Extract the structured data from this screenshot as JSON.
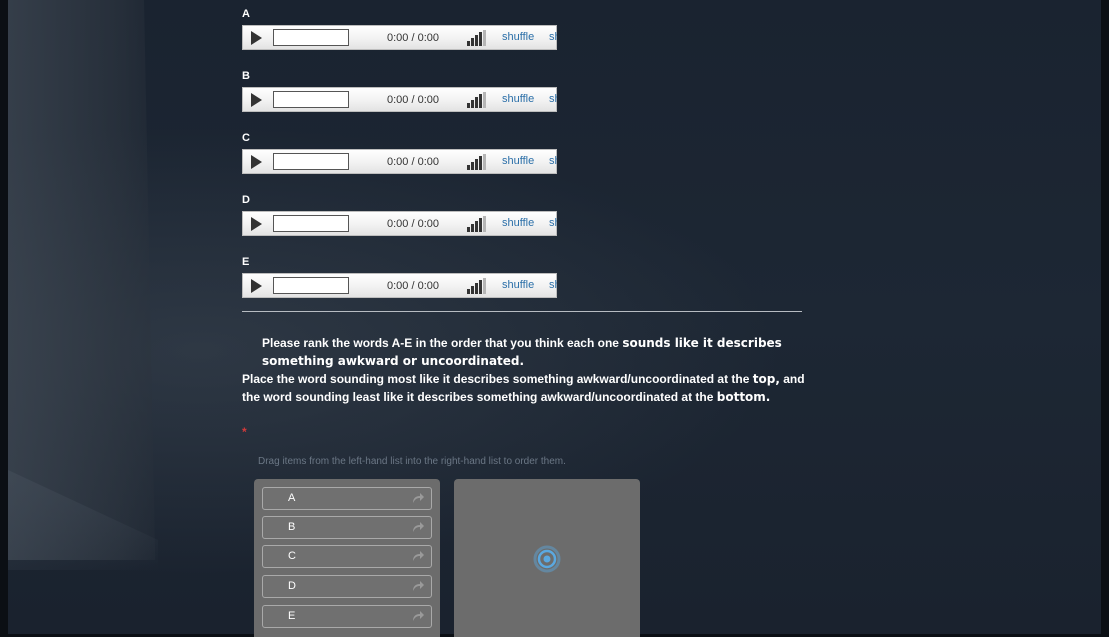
{
  "players": [
    {
      "letter": "A",
      "time": "0:00 / 0:00",
      "shuffle": "shuffle",
      "clipped": "sh"
    },
    {
      "letter": "B",
      "time": "0:00 / 0:00",
      "shuffle": "shuffle",
      "clipped": "sh"
    },
    {
      "letter": "C",
      "time": "0:00 / 0:00",
      "shuffle": "shuffle",
      "clipped": "sh"
    },
    {
      "letter": "D",
      "time": "0:00 / 0:00",
      "shuffle": "shuffle",
      "clipped": "sh"
    },
    {
      "letter": "E",
      "time": "0:00 / 0:00",
      "shuffle": "shuffle",
      "clipped": "sh"
    }
  ],
  "question": {
    "part1": "Please rank the words A-E in the order that you think each one ",
    "part1_strong": "sounds like it describes something awkward or uncoordinated.",
    "part2": "Place the word sounding most like it describes something awkward/uncoordinated at the ",
    "part2_strong": "top,",
    "part3": " and the word sounding least like it describes something awkward/uncoordinated at the ",
    "part3_strong": "bottom.",
    "required_mark": "*"
  },
  "instruction": "Drag items from the left-hand list into the right-hand list to order them.",
  "ranking": {
    "left_items": [
      "A",
      "B",
      "C",
      "D",
      "E"
    ],
    "right_items": []
  },
  "icons": {
    "play": "play-icon",
    "volume": "volume-icon",
    "drag": "drag-arrow-icon",
    "loading": "loading-spinner-icon"
  },
  "colors": {
    "background": "#1c2633",
    "link": "#2b6fa8",
    "required": "#d23a3a",
    "list_bg": "#6c6c6c",
    "spinner": "#5aa8e0"
  }
}
